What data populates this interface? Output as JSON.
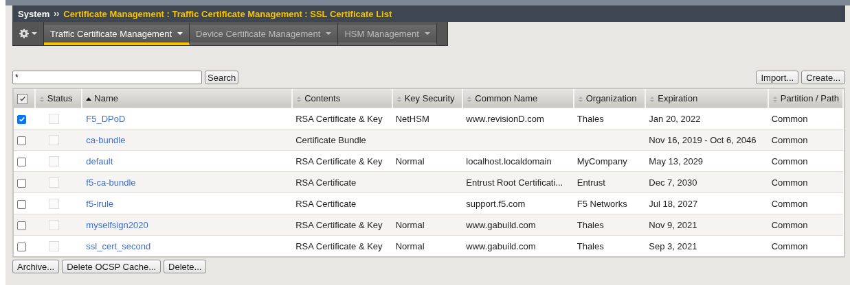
{
  "breadcrumb": {
    "root": "System",
    "separator": "››",
    "path": "Certificate Management : Traffic Certificate Management : SSL Certificate List"
  },
  "tabs": [
    {
      "label": "Traffic Certificate Management",
      "selected": true
    },
    {
      "label": "Device Certificate Management",
      "selected": false
    },
    {
      "label": "HSM Management",
      "selected": false
    }
  ],
  "search": {
    "value": "*",
    "button": "Search"
  },
  "top_buttons": [
    "Import...",
    "Create..."
  ],
  "table": {
    "all_checked": true,
    "columns": [
      {
        "label": "Status",
        "sorted": false
      },
      {
        "label": "Name",
        "sorted": true
      },
      {
        "label": "Contents",
        "sorted": false
      },
      {
        "label": "Key Security",
        "sorted": false
      },
      {
        "label": "Common Name",
        "sorted": false
      },
      {
        "label": "Organization",
        "sorted": false
      },
      {
        "label": "Expiration",
        "sorted": false
      },
      {
        "label": "Partition / Path",
        "sorted": false
      }
    ],
    "rows": [
      {
        "checked": true,
        "name": "F5_DPoD",
        "contents": "RSA Certificate & Key",
        "key_security": "NetHSM",
        "common_name": "www.revisionD.com",
        "organization": "Thales",
        "expiration": "Jan 20, 2022",
        "partition": "Common"
      },
      {
        "checked": false,
        "name": "ca-bundle",
        "contents": "Certificate Bundle",
        "key_security": "",
        "common_name": "",
        "organization": "",
        "expiration": "Nov 16, 2019 - Oct 6, 2046",
        "partition": "Common"
      },
      {
        "checked": false,
        "name": "default",
        "contents": "RSA Certificate & Key",
        "key_security": "Normal",
        "common_name": "localhost.localdomain",
        "organization": "MyCompany",
        "expiration": "May 13, 2029",
        "partition": "Common"
      },
      {
        "checked": false,
        "name": "f5-ca-bundle",
        "contents": "RSA Certificate",
        "key_security": "",
        "common_name": "Entrust Root Certificati...",
        "organization": "Entrust",
        "expiration": "Dec 7, 2030",
        "partition": "Common"
      },
      {
        "checked": false,
        "name": "f5-irule",
        "contents": "RSA Certificate",
        "key_security": "",
        "common_name": "support.f5.com",
        "organization": "F5 Networks",
        "expiration": "Jul 18, 2027",
        "partition": "Common"
      },
      {
        "checked": false,
        "name": "myselfsign2020",
        "contents": "RSA Certificate & Key",
        "key_security": "Normal",
        "common_name": "www.gabuild.com",
        "organization": "Thales",
        "expiration": "Nov 9, 2021",
        "partition": "Common"
      },
      {
        "checked": false,
        "name": "ssl_cert_second",
        "contents": "RSA Certificate & Key",
        "key_security": "Normal",
        "common_name": "www.gabuild.com",
        "organization": "Thales",
        "expiration": "Sep 3, 2021",
        "partition": "Common"
      }
    ]
  },
  "bottom_buttons": [
    "Archive...",
    "Delete OCSP Cache...",
    "Delete..."
  ]
}
